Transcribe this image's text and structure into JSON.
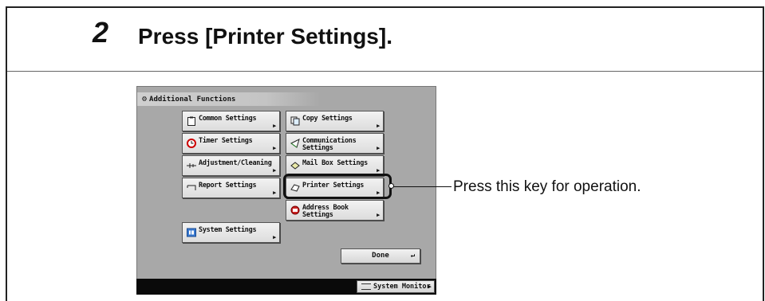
{
  "step": {
    "number": "2",
    "instruction": "Press [Printer Settings]."
  },
  "panel": {
    "title": "Additional Functions",
    "buttons": [
      {
        "label": "Common Settings",
        "icon": "clipboard-icon"
      },
      {
        "label": "Copy Settings",
        "icon": "copy-icon"
      },
      {
        "label": "Timer Settings",
        "icon": "clock-icon"
      },
      {
        "label": "Communications Settings",
        "icon": "send-icon"
      },
      {
        "label": "Adjustment/Cleaning",
        "icon": "adjustment-icon"
      },
      {
        "label": "Mail Box Settings",
        "icon": "mailbox-icon"
      },
      {
        "label": "Report Settings",
        "icon": "report-icon"
      },
      {
        "label": "Printer Settings",
        "icon": "printer-icon"
      },
      {
        "label": "Address Book Settings",
        "icon": "address-book-icon"
      },
      {
        "label": "System Settings",
        "icon": "system-icon"
      }
    ],
    "done_label": "Done",
    "system_monitor_label": "System Monitor"
  },
  "callout": {
    "text": "Press this key for operation."
  }
}
